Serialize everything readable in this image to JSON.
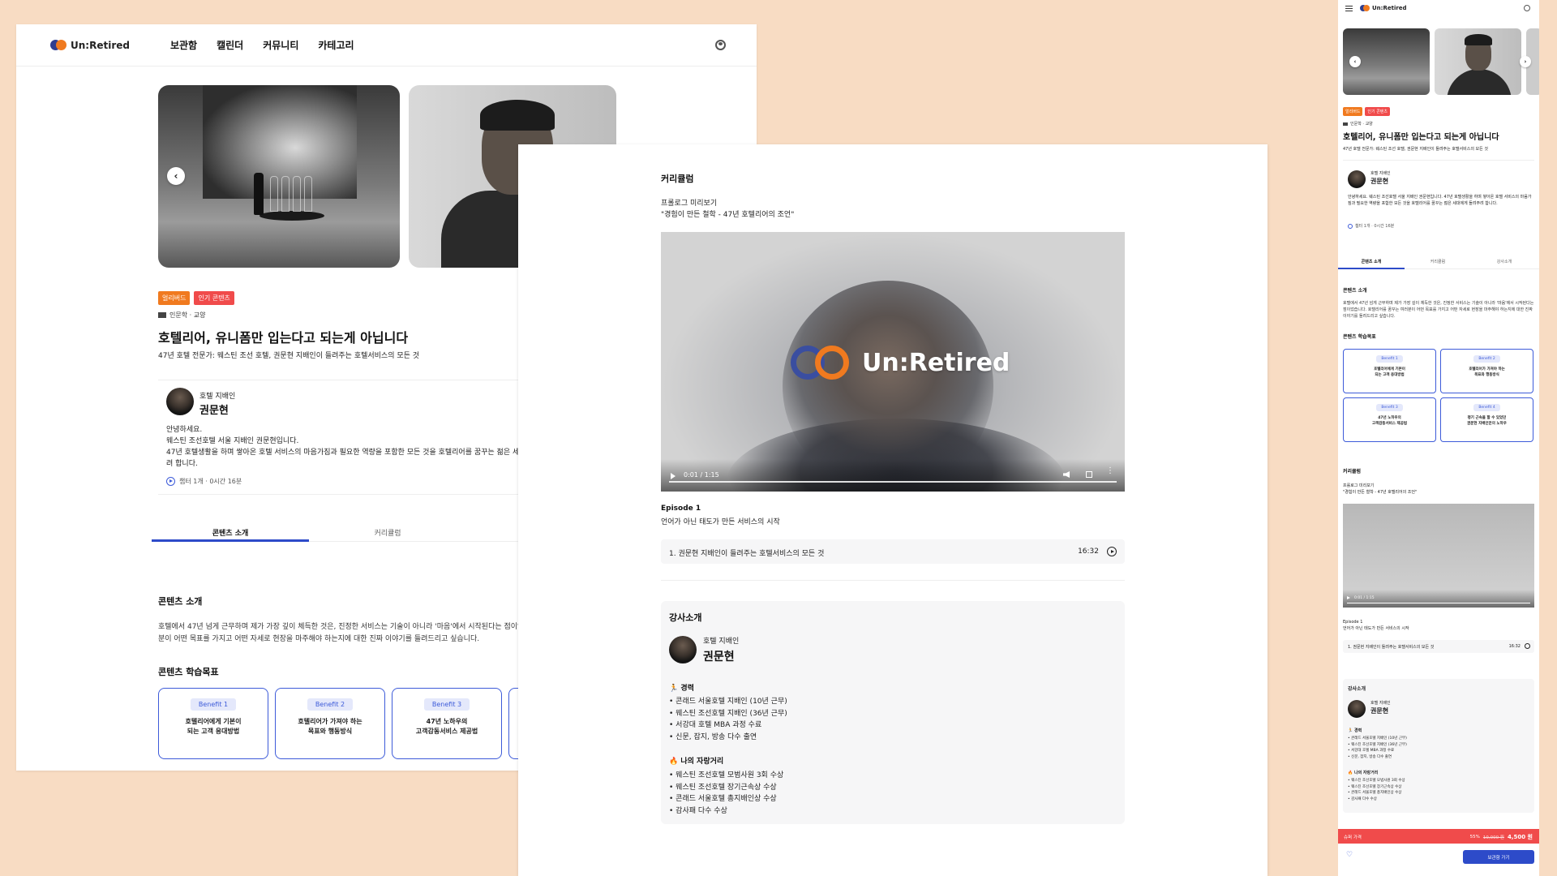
{
  "brand": {
    "name": "Un:Retired"
  },
  "nav": {
    "items": [
      "보관함",
      "캘린더",
      "커뮤니티",
      "카테고리"
    ]
  },
  "course": {
    "badges": [
      "얼리버드",
      "인기 콘텐츠"
    ],
    "category": "인문학 · 교양",
    "title": "호텔리어, 유니폼만 입는다고 되는게 아닙니다",
    "subtitle": "47년 호텔 전문가: 웨스틴 조선 호텔, 권문현 지배인이 들려주는 호텔서비스의 모든 것",
    "meta": "챕터 1개 · 0시간 16분"
  },
  "instructor": {
    "role": "호텔 지배인",
    "name": "권문현",
    "bio": [
      "안녕하세요.",
      "웨스틴 조선호텔 서울 지배인 권문현입니다.",
      "47년 호텔생활을 하며 쌓아온 호텔 서비스의 마음가짐과 필요한 역량을 포함한 모든 것을 호텔리어를 꿈꾸는 젊은 세대",
      "려 합니다."
    ],
    "bio_mobile": "안녕하세요. 웨스틴 조선호텔 서울 지배인 권문현입니다. 47년 호텔생활을 하며 쌓아온 호텔 서비스의 마음가짐과 필요한 역량을 포함한 모든 것을 호텔리어를 꿈꾸는 젊은 세대에게 들려주려 합니다.",
    "career_title": "경력",
    "career": [
      "콘래드 서울호텔 지배인 (10년 근무)",
      "웨스틴 조선호텔 지배인 (36년 근무)",
      "서강대 호텔 MBA 과정 수료",
      "신문, 잡지, 방송 다수 출연"
    ],
    "awards_title": "나의 자랑거리",
    "awards": [
      "웨스틴 조선호텔 모범사원 3회 수상",
      "웨스틴 조선호텔 장기근속상 수상",
      "콘래드 서울호텔 총지배인상 수상",
      "감사패 다수 수상"
    ],
    "section_title": "강사소개"
  },
  "tabs": [
    "콘텐츠 소개",
    "커리큘럼"
  ],
  "tabs_mobile": [
    "콘텐츠 소개",
    "커리큘럼",
    "강사소개"
  ],
  "intro": {
    "heading": "콘텐츠 소개",
    "text": "호텔에서 47년 넘게 근무하며 제가 가장 깊이 체득한 것은, 진정한 서비스는 기술이 아니라 '마음'에서 시작된다는 점이었습",
    "text2": "분이 어떤 목표를 가지고 어떤 자세로 현장을 마주해야 하는지에 대한 진짜 이야기를 들려드리고 싶습니다.",
    "text_mobile": "호텔에서 47년 넘게 근무하며 제가 가장 깊이 체득한 것은, 진정한 서비스는 기술이 아니라 '마음'에서 시작된다는 점이었습니다. 호텔리어를 꿈꾸는 여러분이 어떤 목표를 가지고 어떤 자세로 현장을 마주해야 하는지에 대한 진짜 이야기를 들려드리고 싶습니다."
  },
  "benefits": {
    "heading": "콘텐츠 학습목표",
    "items": [
      {
        "label": "Benefit 1",
        "line1": "호텔리어에게 기본이",
        "line2": "되는 고객 응대방법"
      },
      {
        "label": "Benefit 2",
        "line1": "호텔리어가 가져야 하는",
        "line2": "목표와 행동방식"
      },
      {
        "label": "Benefit 3",
        "line1": "47년 노하우의",
        "line2": "고객감동서비스 제공법"
      },
      {
        "label": "Benefit 4",
        "line1": "평기 근속을 할 수 있었던",
        "line2": "권문현 지배인만의 노하우"
      }
    ]
  },
  "curriculum": {
    "heading": "커리큘럼",
    "prolog_label": "프롤로그 미리보기",
    "prolog_title": "\"경험이 만든 철학 - 47년 호텔리어의 조언\"",
    "video_time": "0:01 / 1:15",
    "episode_num": "Episode 1",
    "episode_title": "언어가 아닌 태도가 만든 서비스의 시작",
    "lesson_title": "1. 권문현 지배인이 들려주는 호텔서비스의 모든 것",
    "lesson_duration": "16:32"
  },
  "purchase": {
    "label": "슈퍼 가격",
    "discount": "55%",
    "original": "10,000 원",
    "final": "4,500 원",
    "button": "보관함 가기"
  },
  "colors": {
    "accent": "#2d4bc9",
    "orange": "#f07a1f",
    "red": "#f04b4b",
    "background": "#f8dcc3"
  },
  "icons": [
    "user-icon",
    "chevron-left-icon",
    "chevron-right-icon",
    "play-circle-icon",
    "menu-icon",
    "heart-icon",
    "volume-icon",
    "fullscreen-icon",
    "more-vertical-icon"
  ]
}
